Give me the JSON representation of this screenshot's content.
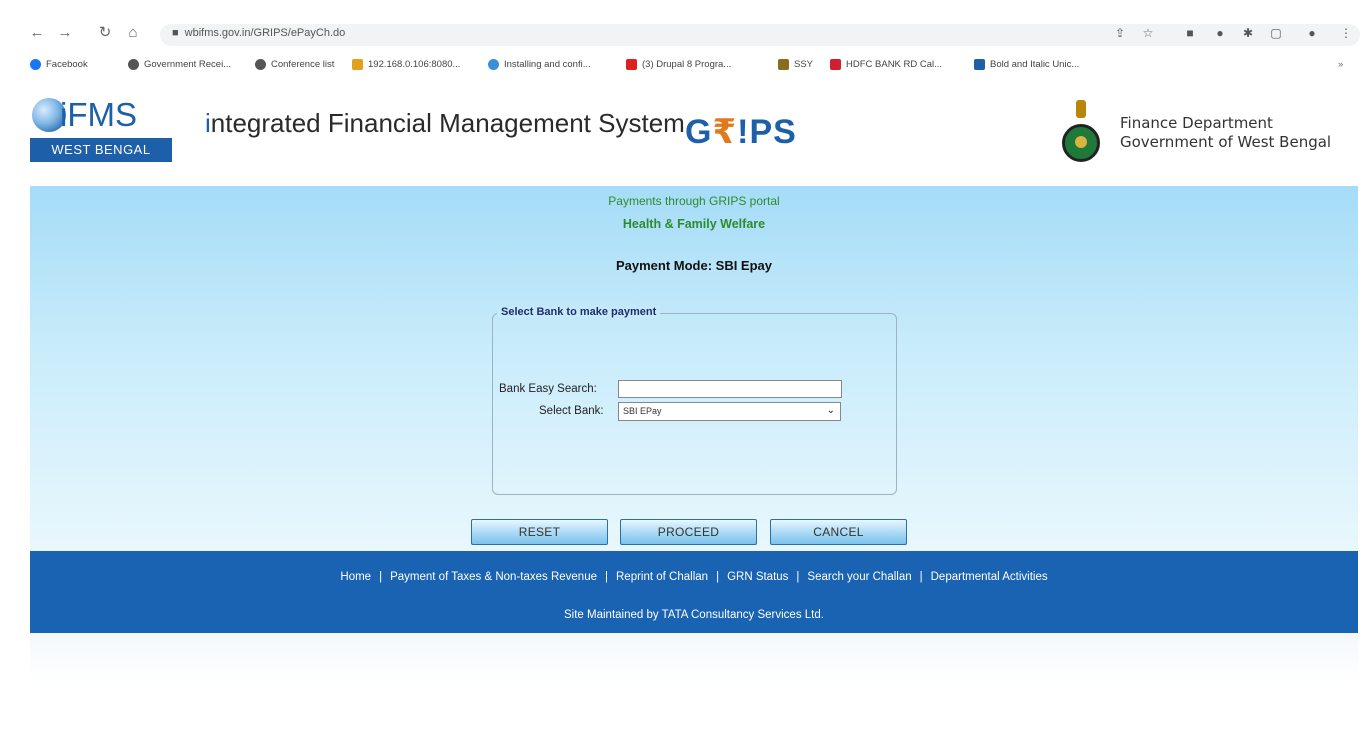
{
  "browser": {
    "url": "wbifms.gov.in/GRIPS/ePayCh.do",
    "bookmarks": [
      {
        "label": "Facebook",
        "color": "#1877f2"
      },
      {
        "label": "Government Recei...",
        "color": "#555555"
      },
      {
        "label": "Conference list",
        "color": "#555555"
      },
      {
        "label": "192.168.0.106:8080...",
        "color": "#e0a020"
      },
      {
        "label": "Installing and confi...",
        "color": "#3b8fd9"
      },
      {
        "label": "(3) Drupal 8 Progra...",
        "color": "#e02020"
      },
      {
        "label": "SSY",
        "color": "#8a6d1c"
      },
      {
        "label": "HDFC BANK RD Cal...",
        "color": "#d02030"
      },
      {
        "label": "Bold and Italic Unic...",
        "color": "#1d5fa8"
      }
    ]
  },
  "header": {
    "logo_text": "iFMS",
    "logo_state": "WEST BENGAL",
    "system_title_first": "i",
    "system_title_rest": "ntegrated Financial Management System",
    "grips_a": "G",
    "grips_r": "₹",
    "grips_b": "!PS",
    "dept_line1": "Finance Department",
    "dept_line2": "Government of West Bengal"
  },
  "main": {
    "portal_text": "Payments through GRIPS portal",
    "department": "Health & Family Welfare",
    "payment_mode": "Payment Mode: SBI Epay",
    "legend": "Select Bank to make payment",
    "search_label": "Bank Easy Search:",
    "search_value": "",
    "select_label": "Select Bank:",
    "select_value": "SBI EPay"
  },
  "buttons": {
    "reset": "RESET",
    "proceed": "PROCEED",
    "cancel": "CANCEL"
  },
  "footer": {
    "links": [
      "Home",
      "Payment of Taxes & Non-taxes Revenue",
      "Reprint of Challan",
      "GRN Status",
      "Search your Challan",
      "Departmental Activities"
    ],
    "maintained": "Site Maintained by TATA Consultancy Services Ltd."
  }
}
